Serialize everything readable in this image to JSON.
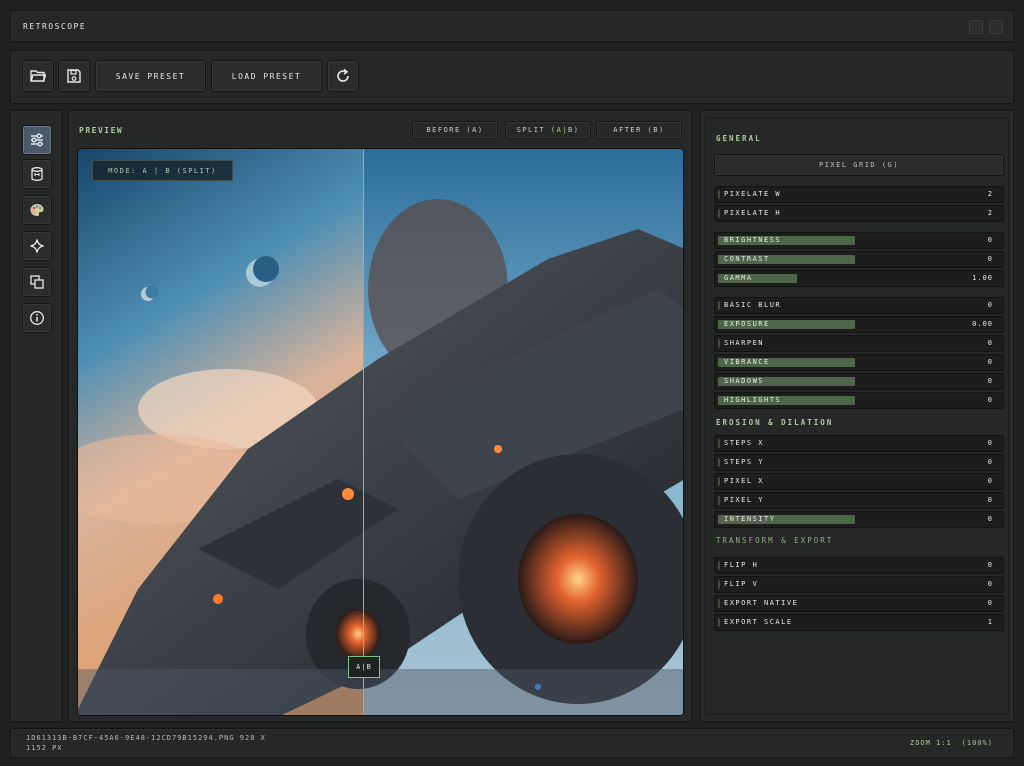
{
  "app": {
    "title": "RETROSCOPE"
  },
  "toolbar": {
    "open_icon": "folder-open-icon",
    "save_icon": "floppy-disk-icon",
    "save_preset_label": "SAVE PRESET",
    "load_preset_label": "LOAD PRESET",
    "reset_icon": "refresh-icon"
  },
  "rail": {
    "items": [
      {
        "icon": "sliders-icon",
        "active": true
      },
      {
        "icon": "layers-cylinder-icon",
        "active": false
      },
      {
        "icon": "palette-icon",
        "active": false
      },
      {
        "icon": "sparkle-icon",
        "active": false
      },
      {
        "icon": "copy-icon",
        "active": false
      },
      {
        "icon": "info-icon",
        "active": false
      }
    ]
  },
  "preview": {
    "label": "PREVIEW",
    "mode_buttons": {
      "before": "BEFORE (A)",
      "split": "SPLIT (A|B)",
      "after": "AFTER (B)"
    },
    "mode_badge": "MODE: A | B (SPLIT)",
    "split_handle": "A|B"
  },
  "settings": {
    "general_title": "GENERAL",
    "pixel_grid_label": "PIXEL GRID (G)",
    "pixelate": [
      {
        "label": "PIXELATE W",
        "value": "2",
        "fill": 0.0
      },
      {
        "label": "PIXELATE H",
        "value": "2",
        "fill": 0.0
      }
    ],
    "tone": [
      {
        "label": "BRIGHTNESS",
        "value": "0",
        "fill": 0.5
      },
      {
        "label": "CONTRAST",
        "value": "0",
        "fill": 0.5
      },
      {
        "label": "GAMMA",
        "value": "1.00",
        "fill": 0.29
      }
    ],
    "effects": [
      {
        "label": "BASIC BLUR",
        "value": "0",
        "fill": 0.0
      },
      {
        "label": "EXPOSURE",
        "value": "0.00",
        "fill": 0.5
      },
      {
        "label": "SHARPEN",
        "value": "0",
        "fill": 0.0
      },
      {
        "label": "VIBRANCE",
        "value": "0",
        "fill": 0.5
      },
      {
        "label": "SHADOWS",
        "value": "0",
        "fill": 0.5
      },
      {
        "label": "HIGHLIGHTS",
        "value": "0",
        "fill": 0.5
      }
    ],
    "erosion_title": "EROSION & DILATION",
    "erosion": [
      {
        "label": "STEPS X",
        "value": "0",
        "fill": 0.0
      },
      {
        "label": "STEPS Y",
        "value": "0",
        "fill": 0.0
      },
      {
        "label": "PIXEL X",
        "value": "0",
        "fill": 0.0
      },
      {
        "label": "PIXEL Y",
        "value": "0",
        "fill": 0.0
      },
      {
        "label": "INTENSITY",
        "value": "0",
        "fill": 0.5
      }
    ],
    "transform_title": "TRANSFORM & EXPORT",
    "transform": [
      {
        "label": "FLIP H",
        "value": "0",
        "fill": 0.0
      },
      {
        "label": "FLIP V",
        "value": "0",
        "fill": 0.0
      },
      {
        "label": "EXPORT NATIVE",
        "value": "0",
        "fill": 0.0
      },
      {
        "label": "EXPORT SCALE",
        "value": "1",
        "fill": 0.0
      }
    ]
  },
  "status": {
    "file_line_1": "1D61313B-B7CF-45A6-9E48-12CD79B15294.PNG   928 X",
    "file_line_2": "1152 PX",
    "zoom": "ZOOM 1:1",
    "zoom_percent": "(100%)"
  },
  "colors": {
    "accent": "#a9cc9a",
    "slider_fill": "#4e6549",
    "split_line": "#7fbf8c",
    "rail_active": "#4a5a6a"
  }
}
